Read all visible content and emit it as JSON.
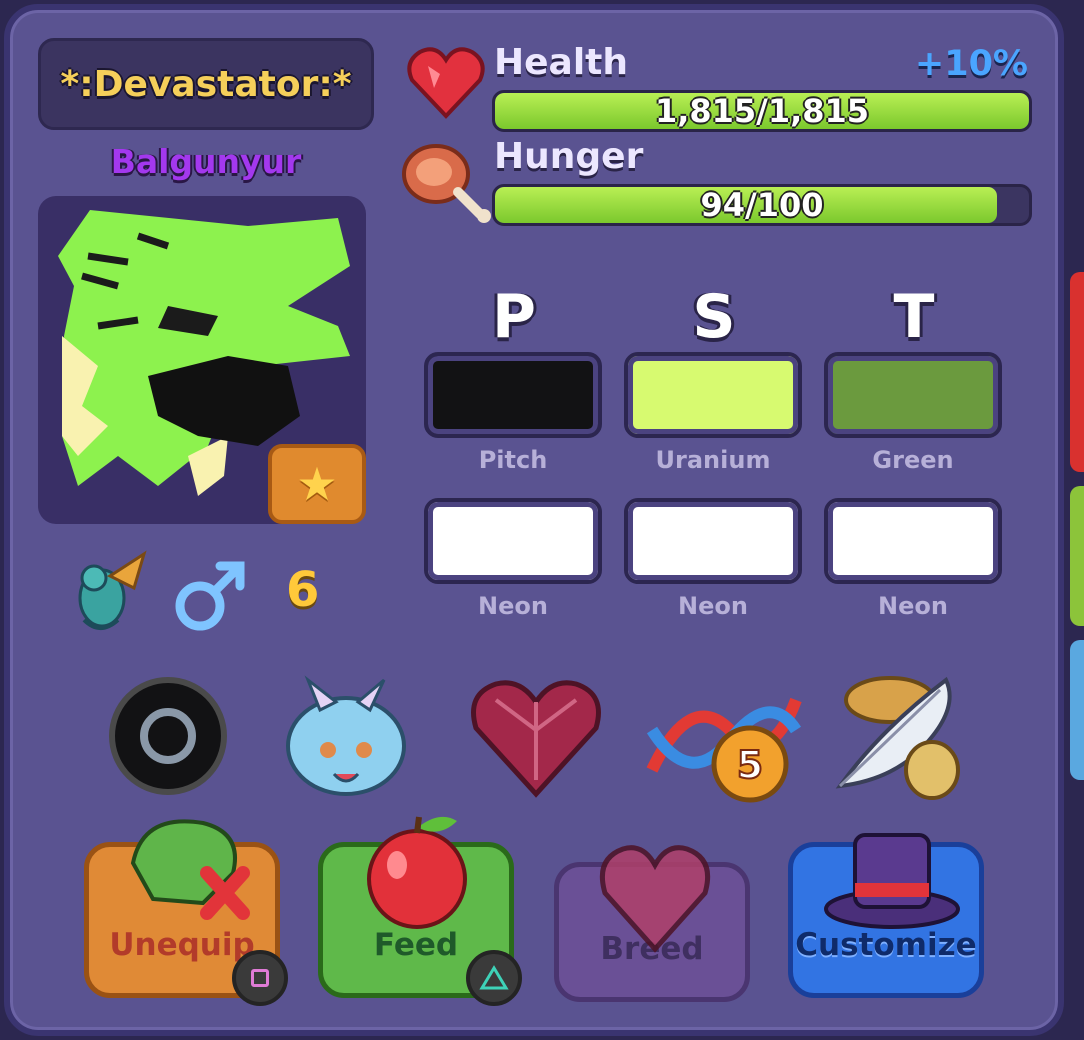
{
  "title": "*:Devastator:*",
  "dragon_name": "Balgunyur",
  "level": "6",
  "stats": {
    "health": {
      "label": "Health",
      "bonus": "+10%",
      "value": "1,815/1,815",
      "fill": 1.0
    },
    "hunger": {
      "label": "Hunger",
      "value": "94/100",
      "fill": 0.94
    }
  },
  "colors": {
    "headers": [
      "P",
      "S",
      "T"
    ],
    "primary": [
      {
        "name": "Pitch",
        "hex": "#121214"
      },
      {
        "name": "Uranium",
        "hex": "#d7fa70"
      },
      {
        "name": "Green",
        "hex": "#6b9a3e"
      }
    ],
    "secondary": [
      {
        "name": "Neon",
        "hex": "#ffffff"
      },
      {
        "name": "Neon",
        "hex": "#ffffff"
      },
      {
        "name": "Neon",
        "hex": "#ffffff"
      }
    ]
  },
  "icons": {
    "species": "dragon-species-icon",
    "gender": "male-gender-icon",
    "row": [
      "eye-orb-icon",
      "baby-dragon-head-icon",
      "crimson-heart-gem-icon",
      "dna-helix-icon",
      "feather-quill-icon"
    ],
    "dna_count": "5"
  },
  "actions": [
    {
      "label": "Unequip",
      "icon": "unequip-dragon-icon",
      "hint": "square-button-hint",
      "color": "#f0a04a"
    },
    {
      "label": "Feed",
      "icon": "apple-icon",
      "hint": "triangle-button-hint",
      "color": "#5bb84a"
    },
    {
      "label": "Breed",
      "icon": "heart-gem-icon",
      "color": "#7b5fa0"
    },
    {
      "label": "Customize",
      "icon": "top-hat-icon",
      "color": "#3274e3"
    }
  ]
}
